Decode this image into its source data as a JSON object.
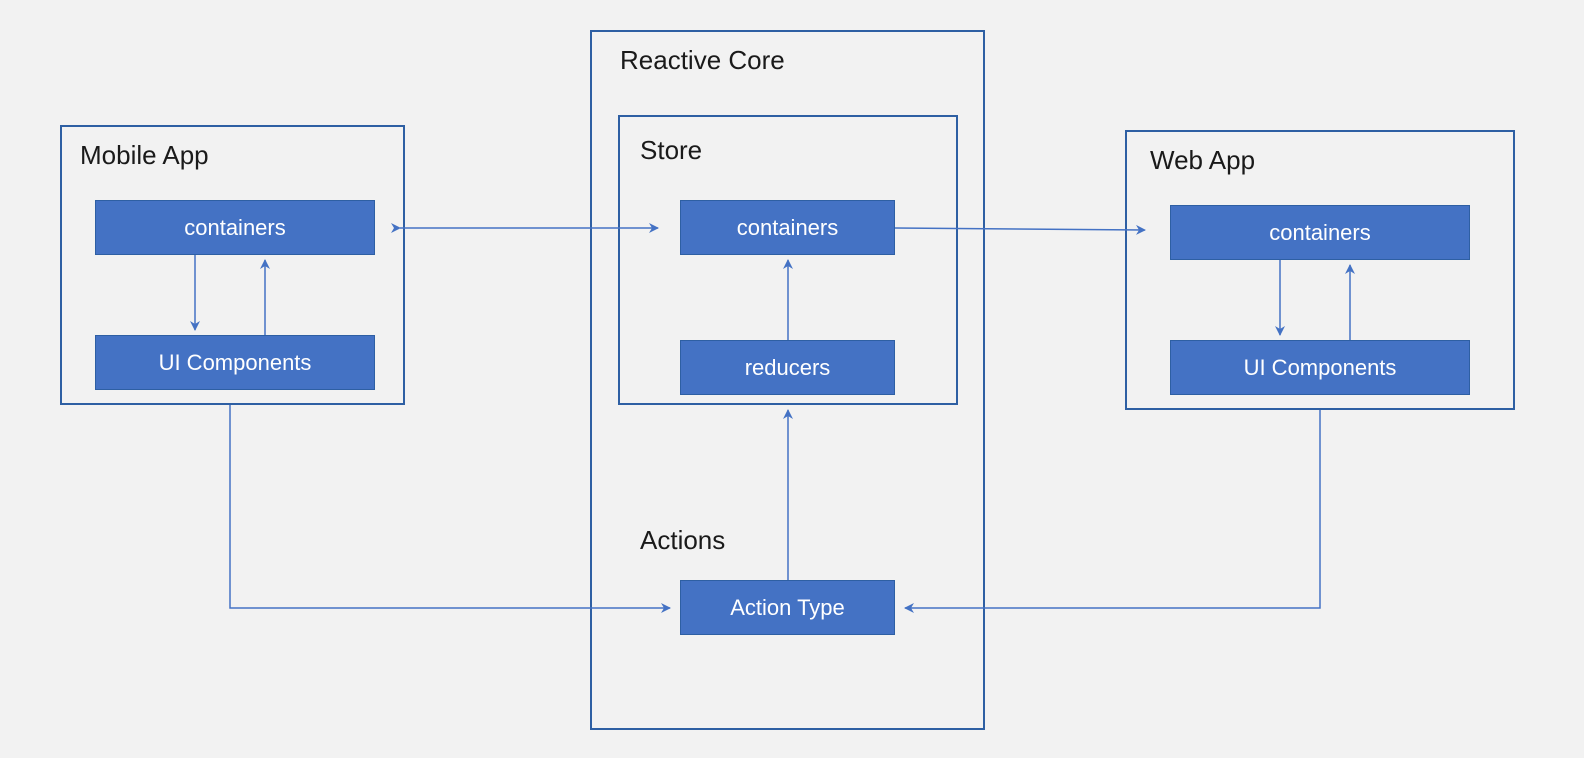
{
  "colors": {
    "box_fill": "#4472c4",
    "box_border": "#2e5fa3",
    "line": "#4472c4",
    "background": "#f2f2f2",
    "text_dark": "#1a1a1a",
    "text_light": "#ffffff"
  },
  "mobile": {
    "title": "Mobile App",
    "containers": "containers",
    "ui_components": "UI Components"
  },
  "core": {
    "title": "Reactive Core",
    "store": {
      "title": "Store",
      "containers": "containers",
      "reducers": "reducers"
    },
    "actions": {
      "title": "Actions",
      "action_type": "Action Type"
    }
  },
  "web": {
    "title": "Web App",
    "containers": "containers",
    "ui_components": "UI Components"
  }
}
